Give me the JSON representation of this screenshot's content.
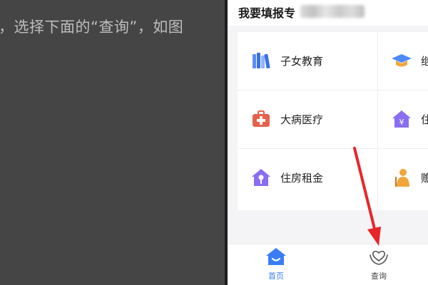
{
  "instruction": "，选择下面的“查询”，如图",
  "app": {
    "header_title": "我要填报专",
    "tiles": [
      {
        "label": "子女教育",
        "icon": "books-icon"
      },
      {
        "label": "继",
        "icon": "graduation-cap-icon"
      },
      {
        "label": "大病医疗",
        "icon": "medical-kit-icon"
      },
      {
        "label": "住",
        "icon": "house-yuan-icon"
      },
      {
        "label": "住房租金",
        "icon": "house-key-icon"
      },
      {
        "label": "赡",
        "icon": "elder-care-icon"
      }
    ],
    "tabs": [
      {
        "label": "首页",
        "icon": "home-icon",
        "active": true
      },
      {
        "label": "查询",
        "icon": "heart-hands-icon",
        "active": false
      }
    ]
  },
  "colors": {
    "accent_blue": "#3b7cf6",
    "purple": "#8a6df0",
    "red": "#e8604c",
    "orange": "#f0a63a",
    "arrow": "#e8262a"
  }
}
